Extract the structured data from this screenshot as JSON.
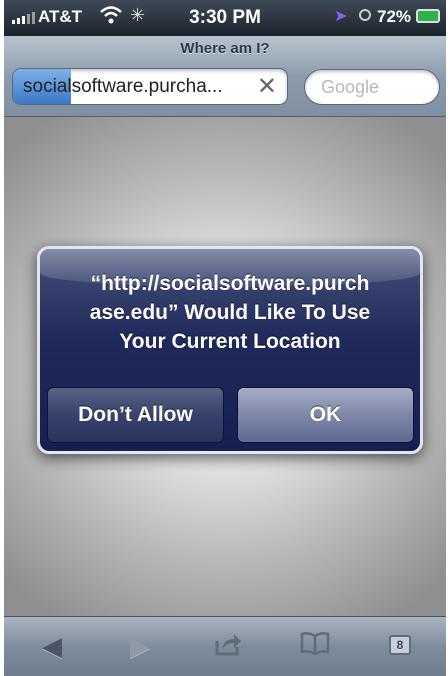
{
  "status_bar": {
    "carrier": "AT&T",
    "time": "3:30 PM",
    "battery": "72%"
  },
  "navbar": {
    "title": "Where am I?",
    "url": "socialsoftware.purcha...",
    "search_placeholder": "Google"
  },
  "alert": {
    "message_line1": "“http://socialsoftware.purch",
    "message_line2": "ase.edu” Would Like To Use",
    "message_line3": "Your Current Location",
    "cancel_label": "Don’t Allow",
    "ok_label": "OK"
  },
  "toolbar": {
    "pages_count": "8"
  },
  "icons": [
    "signal-icon",
    "wifi-icon",
    "activity-icon",
    "location-arrow-icon",
    "alarm-icon",
    "battery-icon",
    "clear-icon",
    "back-icon",
    "forward-icon",
    "share-icon",
    "bookmarks-icon",
    "pages-icon"
  ],
  "colors": {
    "alert_bg": "#1f2a5a",
    "navbar_bg": "#8d9cac",
    "location_arrow": "#8f5cf0",
    "battery_fill": "#2bb34a"
  }
}
